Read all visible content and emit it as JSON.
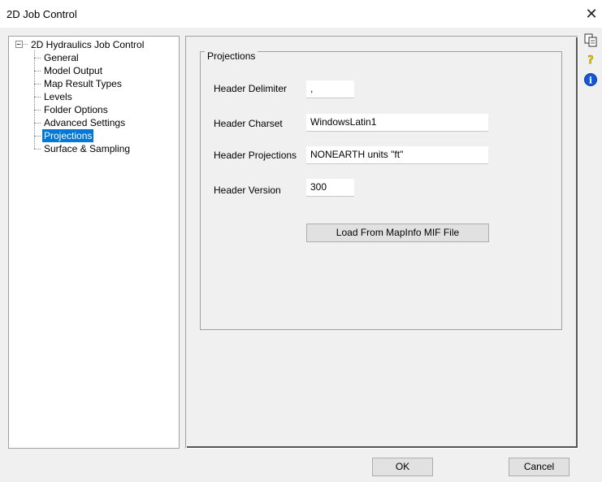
{
  "window": {
    "title": "2D Job Control"
  },
  "tree": {
    "root": "2D Hydraulics Job Control",
    "items": [
      {
        "label": "General"
      },
      {
        "label": "Model Output"
      },
      {
        "label": "Map Result Types"
      },
      {
        "label": "Levels"
      },
      {
        "label": "Folder Options"
      },
      {
        "label": "Advanced Settings"
      },
      {
        "label": "Projections",
        "selected": true
      },
      {
        "label": "Surface & Sampling"
      }
    ]
  },
  "projections": {
    "group_title": "Projections",
    "fields": [
      {
        "label": "Header Delimiter",
        "value": ","
      },
      {
        "label": "Header Charset",
        "value": "WindowsLatin1"
      },
      {
        "label": "Header Projections",
        "value": "NONEARTH units \"ft\""
      },
      {
        "label": "Header Version",
        "value": "300"
      }
    ],
    "load_button": "Load From MapInfo MIF File"
  },
  "buttons": {
    "ok": "OK",
    "cancel": "Cancel"
  },
  "side_icons": [
    "copy-icon",
    "help-icon",
    "info-icon"
  ],
  "colors": {
    "selection": "#0078d7",
    "help": "#e6c700",
    "info": "#1456d6"
  }
}
